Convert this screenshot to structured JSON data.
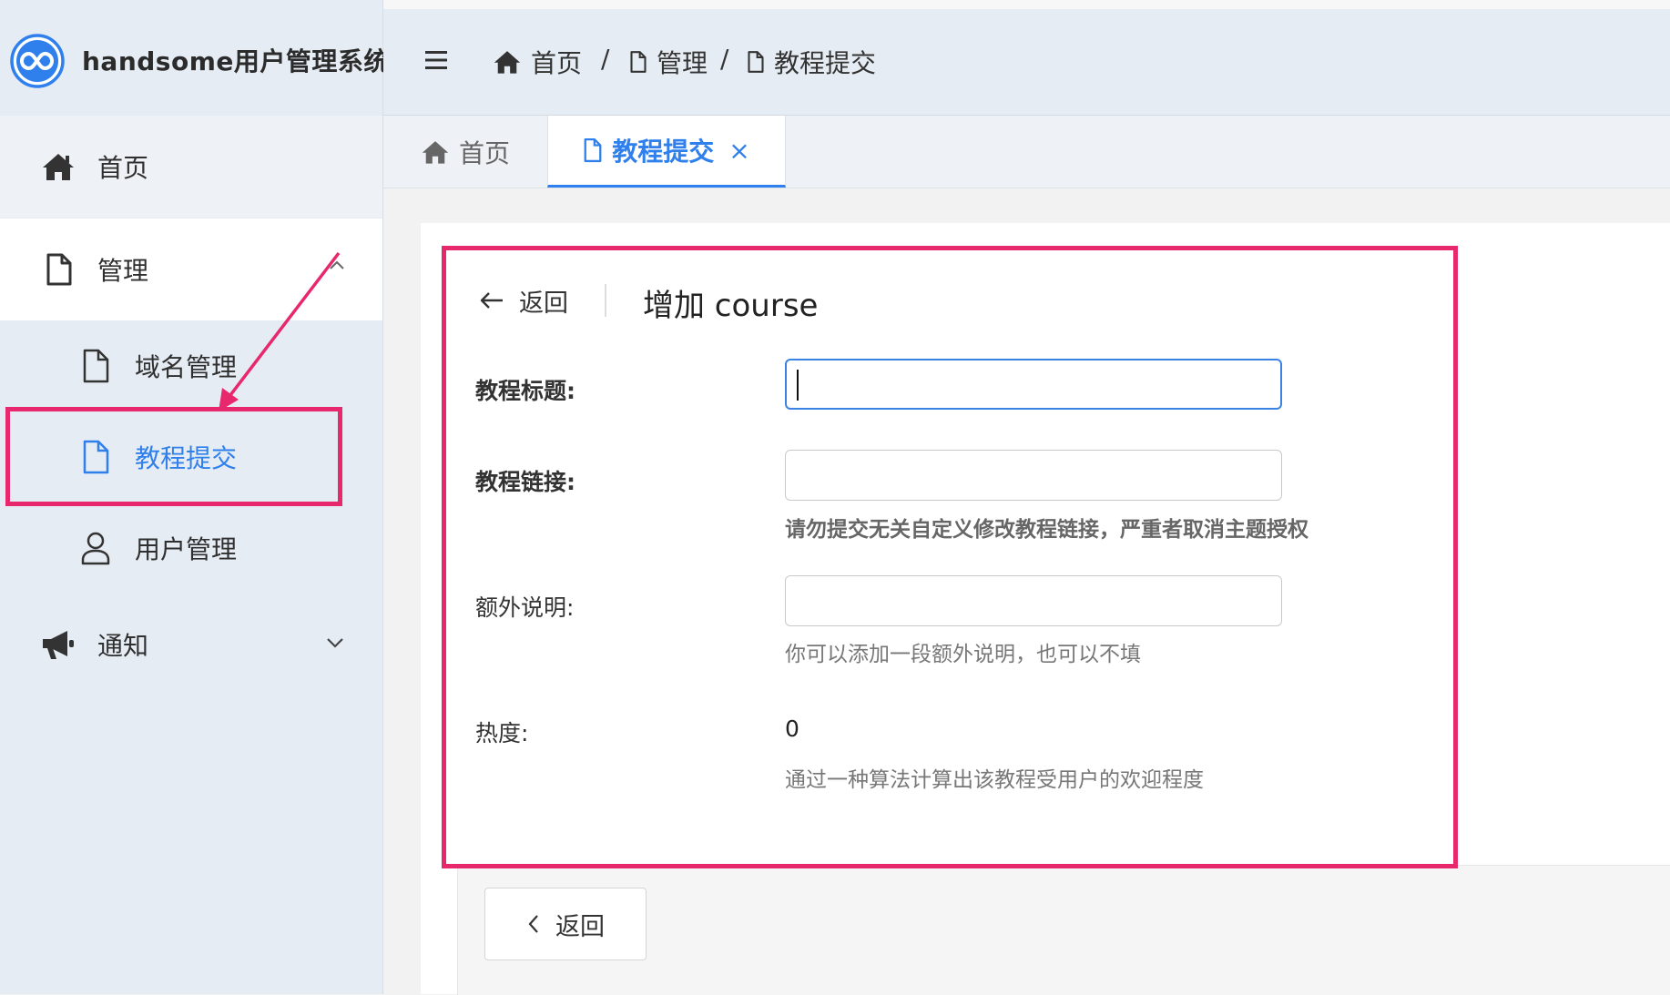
{
  "app": {
    "title": "handsome用户管理系统",
    "accent": "#2f80ed",
    "annotation_color": "#e8286d"
  },
  "sidebar": {
    "items": [
      {
        "label": "首页",
        "icon": "home-icon"
      },
      {
        "label": "管理",
        "icon": "file-icon"
      },
      {
        "label": "域名管理",
        "icon": "file-icon"
      },
      {
        "label": "教程提交",
        "icon": "file-icon",
        "active": true
      },
      {
        "label": "用户管理",
        "icon": "user-icon"
      },
      {
        "label": "通知",
        "icon": "megaphone-icon"
      }
    ]
  },
  "header": {
    "menu_icon": "hamburger-icon",
    "breadcrumb": [
      {
        "label": "首页",
        "icon": "home-icon"
      },
      {
        "label": "管理",
        "icon": "file-icon"
      },
      {
        "label": "教程提交",
        "icon": "file-icon"
      }
    ],
    "separator": "/"
  },
  "tabs": [
    {
      "label": "首页",
      "icon": "home-icon"
    },
    {
      "label": "教程提交",
      "icon": "file-icon",
      "close": "×",
      "active": true
    }
  ],
  "page_header": {
    "back_label": "返回",
    "title": "增加 course"
  },
  "form": {
    "title_label": "教程标题:",
    "title_value": "",
    "link_label": "教程链接:",
    "link_value": "",
    "link_help": "请勿提交无关自定义修改教程链接，严重者取消主题授权",
    "extra_label": "额外说明:",
    "extra_value": "",
    "extra_help": "你可以添加一段额外说明，也可以不填",
    "heat_label": "热度:",
    "heat_value": "0",
    "heat_help": "通过一种算法计算出该教程受用户的欢迎程度"
  },
  "footer_button": {
    "label": "返回"
  }
}
